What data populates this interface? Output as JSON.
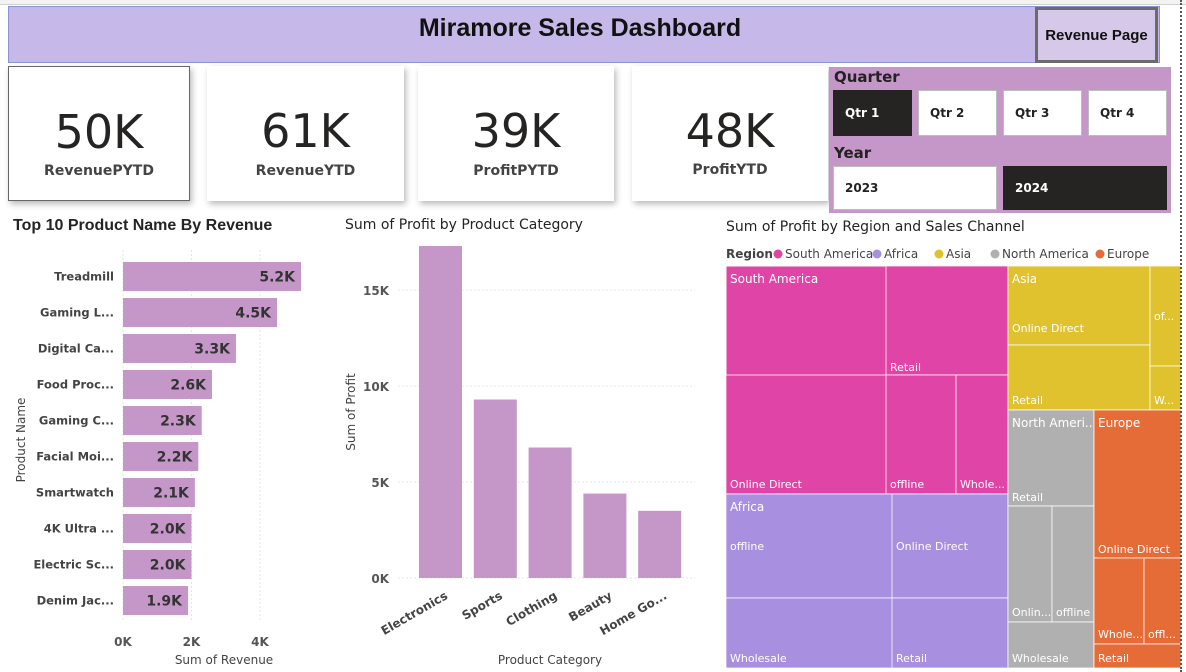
{
  "header": {
    "title": "Miramore Sales Dashboard",
    "revenue_button": "Revenue Page"
  },
  "kpis": [
    {
      "value": "50K",
      "label": "RevenuePYTD"
    },
    {
      "value": "61K",
      "label": "RevenueYTD"
    },
    {
      "value": "39K",
      "label": "ProfitPYTD"
    },
    {
      "value": "48K",
      "label": "ProfitYTD"
    }
  ],
  "slicers": {
    "quarter_title": "Quarter",
    "quarters": [
      "Qtr 1",
      "Qtr 2",
      "Qtr 3",
      "Qtr 4"
    ],
    "quarter_selected": "Qtr 1",
    "year_title": "Year",
    "years": [
      "2023",
      "2024"
    ],
    "year_selected": "2024"
  },
  "chart_data": [
    {
      "type": "bar",
      "orientation": "horizontal",
      "title": "Top 10 Product Name By Revenue",
      "xlabel": "Sum of Revenue",
      "ylabel": "Product Name",
      "categories": [
        "Treadmill",
        "Gaming L...",
        "Digital Ca...",
        "Food Proc...",
        "Gaming C...",
        "Facial Moi...",
        "Smartwatch",
        "4K Ultra ...",
        "Electric Sc...",
        "Denim Jac..."
      ],
      "values": [
        5200,
        4500,
        3300,
        2600,
        2300,
        2200,
        2100,
        2000,
        2000,
        1900
      ],
      "data_labels": [
        "5.2K",
        "4.5K",
        "3.3K",
        "2.6K",
        "2.3K",
        "2.2K",
        "2.1K",
        "2.0K",
        "2.0K",
        "1.9K"
      ],
      "xticks": [
        "0K",
        "2K",
        "4K"
      ],
      "xlim": [
        0,
        5400
      ],
      "color": "#c596c8"
    },
    {
      "type": "bar",
      "title": "Sum of Profit by Product Category",
      "xlabel": "Product Category",
      "ylabel": "Sum of Profit",
      "categories": [
        "Electronics",
        "Sports",
        "Clothing",
        "Beauty",
        "Home Go..."
      ],
      "values": [
        17300,
        9300,
        6800,
        4400,
        3500
      ],
      "yticks": [
        "0K",
        "5K",
        "10K",
        "15K"
      ],
      "ylim": [
        0,
        17700
      ],
      "color": "#c596c8"
    },
    {
      "type": "treemap",
      "title": "Sum of Profit by Region and Sales Channel",
      "legend_title": "Region",
      "legend": [
        {
          "name": "South America",
          "color": "#e044a7"
        },
        {
          "name": "Africa",
          "color": "#a98fdf"
        },
        {
          "name": "Asia",
          "color": "#e0c22e"
        },
        {
          "name": "North America",
          "color": "#b0b0b0"
        },
        {
          "name": "Europe",
          "color": "#e66c37"
        }
      ],
      "groups": [
        {
          "region": "South America",
          "label": "South America",
          "color": "#e044a7",
          "channels": [
            {
              "label": "Online Direct"
            },
            {
              "label": "Retail"
            },
            {
              "label": "offline"
            },
            {
              "label": "Whole..."
            }
          ]
        },
        {
          "region": "Africa",
          "label": "Africa",
          "color": "#a98fdf",
          "channels": [
            {
              "label": "offline"
            },
            {
              "label": "Online Direct"
            },
            {
              "label": "Wholesale"
            },
            {
              "label": "Retail"
            }
          ]
        },
        {
          "region": "Asia",
          "label": "Asia",
          "color": "#e0c22e",
          "channels": [
            {
              "label": "Online Direct"
            },
            {
              "label": "Retail"
            },
            {
              "label": "of..."
            },
            {
              "label": "W..."
            }
          ]
        },
        {
          "region": "North America",
          "label": "North Ameri...",
          "color": "#b0b0b0",
          "channels": [
            {
              "label": "Retail"
            },
            {
              "label": "Onlin..."
            },
            {
              "label": "offline"
            },
            {
              "label": "Wholesale"
            }
          ]
        },
        {
          "region": "Europe",
          "label": "Europe",
          "color": "#e66c37",
          "channels": [
            {
              "label": "Online Direct"
            },
            {
              "label": "Whole..."
            },
            {
              "label": "offl..."
            },
            {
              "label": "Retail"
            }
          ]
        }
      ]
    }
  ]
}
